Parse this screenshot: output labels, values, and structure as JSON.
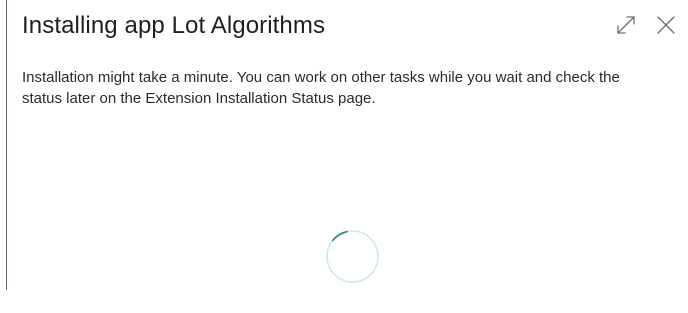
{
  "dialog": {
    "title": "Installing app Lot Algorithms",
    "message": "Installation might take a minute. You can work on other tasks while you wait and check the status later on the Extension Installation Status page.",
    "actions": {
      "expand_icon": "expand-icon",
      "close_icon": "close-icon"
    },
    "loading_icon": "spinner-icon"
  },
  "colors": {
    "spinner_track": "#cfe9ea",
    "spinner_arc": "#2f8a8f",
    "icon": "#707070"
  }
}
